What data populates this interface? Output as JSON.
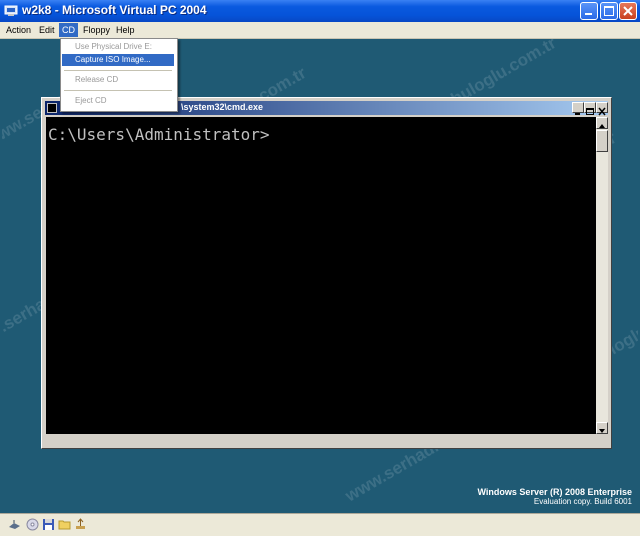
{
  "window": {
    "title": "w2k8 - Microsoft Virtual PC 2004"
  },
  "menubar": {
    "items": [
      {
        "label": "Action"
      },
      {
        "label": "Edit"
      },
      {
        "label": "CD"
      },
      {
        "label": "Floppy"
      },
      {
        "label": "Help"
      }
    ],
    "active": "CD"
  },
  "cd_menu": {
    "items": [
      {
        "label": "Use Physical Drive E:",
        "enabled": false
      },
      {
        "label": "Capture ISO Image...",
        "enabled": true,
        "selected": true
      },
      {
        "label": "Release CD",
        "enabled": false
      },
      {
        "label": "Eject CD",
        "enabled": false
      }
    ]
  },
  "cmd_window": {
    "title_suffix": "\\system32\\cmd.exe",
    "prompt": "C:\\Users\\Administrator>"
  },
  "desktop": {
    "brand_line1": "Windows Server (R) 2008 Enterprise",
    "brand_line2": "Evaluation copy. Build 6001",
    "watermark": "www.serhadmakbuloglu.com.tr"
  },
  "statusbar": {
    "icons": [
      "network-icon",
      "cd-icon",
      "floppy-icon",
      "shared-folder-icon",
      "usb-icon"
    ]
  },
  "colors": {
    "desktop_bg": "#1f5a74",
    "titlebar": "#0653d8",
    "menu_highlight": "#316ac5"
  }
}
